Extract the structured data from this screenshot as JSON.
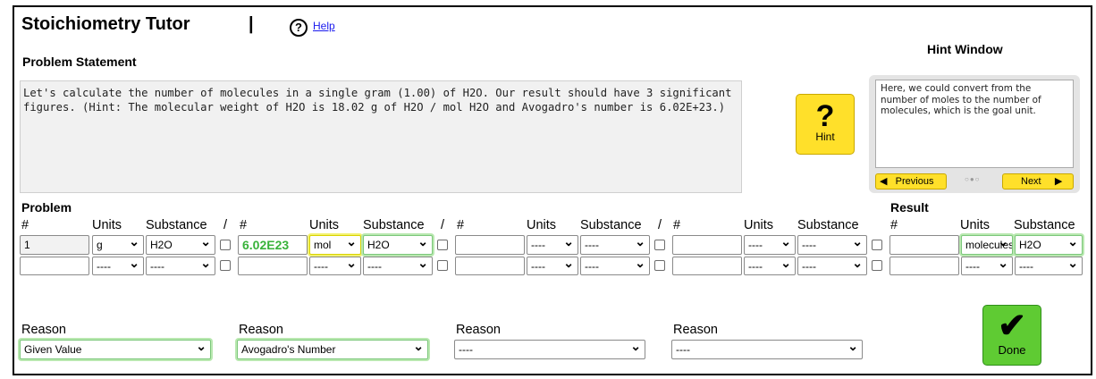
{
  "app": {
    "title": "Stoichiometry Tutor",
    "separator": "|",
    "help_icon": "?",
    "help_label": "Help"
  },
  "problem_statement": {
    "heading": "Problem Statement",
    "text": "Let's calculate the number of molecules in a single gram (1.00) of H2O. Our result should have 3 significant figures. (Hint: The molecular weight of H2O is 18.02 g of H2O / mol H2O and Avogadro's number is 6.02E+23.)"
  },
  "hint": {
    "title": "Hint Window",
    "button_icon": "?",
    "button_label": "Hint",
    "text": "Here, we could convert from the number of moles to the number of molecules, which is the goal unit.",
    "previous_label": "Previous",
    "next_label": "Next",
    "dots": "○●○"
  },
  "problem_section": {
    "heading": "Problem",
    "result_heading": "Result"
  },
  "columns": {
    "number": "#",
    "units": "Units",
    "substance": "Substance",
    "slash": "/"
  },
  "rows": [
    {
      "terms": [
        {
          "number": "1",
          "units": "g",
          "substance": "H2O"
        },
        {
          "number": "6.02E23",
          "units": "mol",
          "substance": "H2O"
        },
        {
          "number": "",
          "units": "----",
          "substance": "----"
        },
        {
          "number": "",
          "units": "----",
          "substance": "----"
        }
      ],
      "result": {
        "number": "",
        "units": "molecules",
        "substance": "H2O"
      }
    },
    {
      "terms": [
        {
          "number": "",
          "units": "----",
          "substance": "----"
        },
        {
          "number": "",
          "units": "----",
          "substance": "----"
        },
        {
          "number": "",
          "units": "----",
          "substance": "----"
        },
        {
          "number": "",
          "units": "----",
          "substance": "----"
        }
      ],
      "result": {
        "number": "",
        "units": "----",
        "substance": "----"
      }
    }
  ],
  "reasons": [
    {
      "label": "Reason",
      "value": "Given Value"
    },
    {
      "label": "Reason",
      "value": "Avogadro's Number"
    },
    {
      "label": "Reason",
      "value": "----"
    },
    {
      "label": "Reason",
      "value": "----"
    }
  ],
  "done": {
    "icon": "✔",
    "label": "Done"
  },
  "colors": {
    "hint_yellow": "#ffe02a",
    "done_green": "#5fcb33",
    "correct_green": "#38b23a",
    "link_blue": "#1a1aee"
  }
}
